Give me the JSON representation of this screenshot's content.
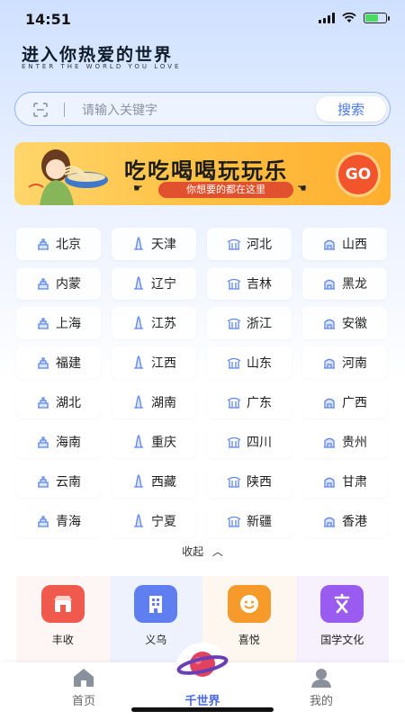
{
  "status_bar": {
    "time": "14:51"
  },
  "header": {
    "title": "进入你热爱的世界",
    "subtitle": "ENTER THE WORLD YOU LOVE"
  },
  "search": {
    "placeholder": "请输入关键字",
    "button_label": "搜索"
  },
  "banner": {
    "title": "吃吃喝喝玩玩乐",
    "subtitle": "你想要的都在这里",
    "go_label": "GO"
  },
  "provinces": [
    "北京",
    "天津",
    "河北",
    "山西",
    "内蒙",
    "辽宁",
    "吉林",
    "黑龙",
    "上海",
    "江苏",
    "浙江",
    "安徽",
    "福建",
    "江西",
    "山东",
    "河南",
    "湖北",
    "湖南",
    "广东",
    "广西",
    "海南",
    "重庆",
    "四川",
    "贵州",
    "云南",
    "西藏",
    "陕西",
    "甘肃",
    "青海",
    "宁夏",
    "新疆",
    "香港"
  ],
  "collapse_label": "收起",
  "categories": [
    {
      "label": "丰收",
      "icon": "shop-icon",
      "color": "#ef5a4d"
    },
    {
      "label": "义乌",
      "icon": "building-icon",
      "color": "#5f7ef0"
    },
    {
      "label": "喜悦",
      "icon": "smile-icon",
      "color": "#f69a2c"
    },
    {
      "label": "国学文化",
      "icon": "culture-icon",
      "color": "#9a5cf0"
    }
  ],
  "tabbar": {
    "items": [
      {
        "label": "首页"
      },
      {
        "label": "千世界"
      },
      {
        "label": "我的"
      }
    ]
  },
  "colors": {
    "accent": "#4877e8",
    "banner_accent": "#e2512d",
    "icon_blue": "#5f86e8"
  }
}
